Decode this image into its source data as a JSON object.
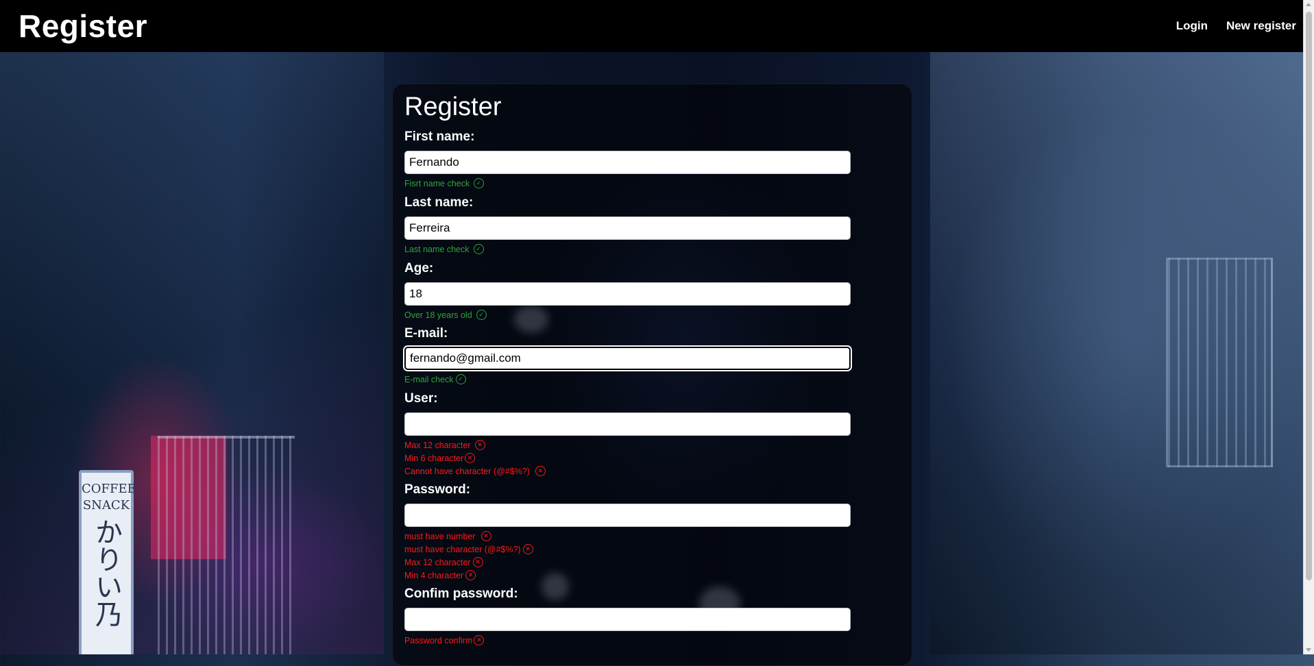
{
  "header": {
    "brand": "Register",
    "nav": {
      "login": "Login",
      "new_register": "New register"
    }
  },
  "background": {
    "sign_top": "COFFEE",
    "sign_mid": "SNACK",
    "sign_jp": "かりい乃"
  },
  "form": {
    "title": "Register",
    "first_name": {
      "label": "First name:",
      "value": "Fernando",
      "checks": [
        {
          "text": "Fisrt name check",
          "status": "ok"
        }
      ]
    },
    "last_name": {
      "label": "Last name:",
      "value": "Ferreira",
      "checks": [
        {
          "text": "Last name check",
          "status": "ok"
        }
      ]
    },
    "age": {
      "label": "Age:",
      "value": "18",
      "checks": [
        {
          "text": "Over 18 years old",
          "status": "ok"
        }
      ]
    },
    "email": {
      "label": "E-mail:",
      "value": "fernando@gmail.com",
      "checks": [
        {
          "text": "E-mail check",
          "status": "ok"
        }
      ]
    },
    "user": {
      "label": "User:",
      "value": "",
      "checks": [
        {
          "text": "Max 12 character",
          "status": "error"
        },
        {
          "text": "Min 6 character",
          "status": "error"
        },
        {
          "text": "Cannot have character (@#$%?)",
          "status": "error"
        }
      ]
    },
    "password": {
      "label": "Password:",
      "value": "",
      "checks": [
        {
          "text": "must have number",
          "status": "error"
        },
        {
          "text": "must have character (@#$%?)",
          "status": "error"
        },
        {
          "text": "Max 12 character",
          "status": "error"
        },
        {
          "text": "Min 4 character",
          "status": "error"
        }
      ]
    },
    "confirm_password": {
      "label": "Confim password:",
      "value": "",
      "checks": [
        {
          "text": "Password confirm",
          "status": "error"
        }
      ]
    }
  },
  "icons": {
    "ok": "check-circle-icon",
    "error": "x-circle-icon"
  },
  "colors": {
    "ok": "#33a33f",
    "error": "#ff1a1a",
    "header_bg": "#000000"
  }
}
